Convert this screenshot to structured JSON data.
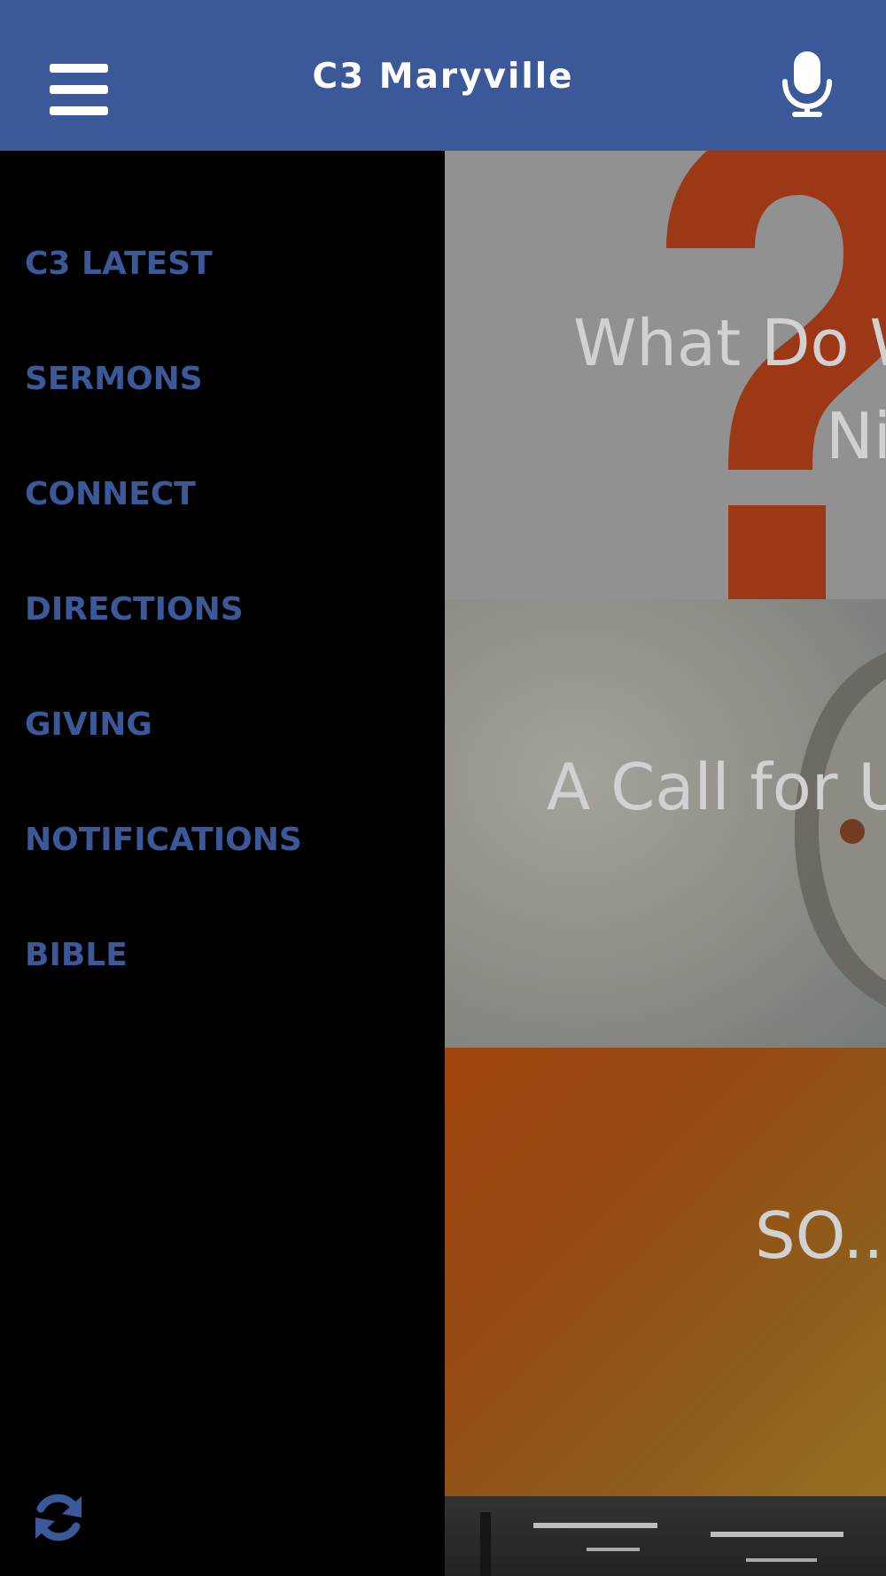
{
  "header": {
    "title": "C3 Maryville",
    "menu_icon": "hamburger-menu-icon",
    "mic_icon": "microphone-icon",
    "background_color": "#3b5998"
  },
  "drawer": {
    "items": [
      {
        "label": "C3 LATEST"
      },
      {
        "label": "SERMONS"
      },
      {
        "label": "CONNECT"
      },
      {
        "label": "DIRECTIONS"
      },
      {
        "label": "GIVING"
      },
      {
        "label": "NOTIFICATIONS"
      },
      {
        "label": "BIBLE"
      }
    ],
    "label_color": "#3b5998",
    "refresh_icon": "refresh-icon"
  },
  "feed": {
    "cards": [
      {
        "title_line1": "What Do W",
        "title_line2": "Ni"
      },
      {
        "title": "A Call for U"
      },
      {
        "title": "SO..."
      },
      {
        "title": ""
      }
    ]
  }
}
